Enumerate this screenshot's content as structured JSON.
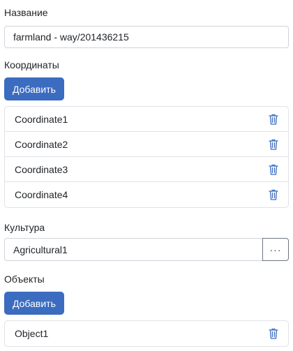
{
  "name": {
    "label": "Название",
    "value": "farmland - way/201436215"
  },
  "coordinates": {
    "label": "Координаты",
    "add_label": "Добавить",
    "items": [
      "Coordinate1",
      "Coordinate2",
      "Coordinate3",
      "Coordinate4"
    ]
  },
  "culture": {
    "label": "Культура",
    "value": "Agricultural1",
    "more_label": "···"
  },
  "objects": {
    "label": "Объекты",
    "add_label": "Добавить",
    "items": [
      "Object1"
    ]
  },
  "colors": {
    "primary": "#3b6cc0",
    "trash_icon": "#3b6cc0",
    "border": "#dfe2e6"
  },
  "icons": {
    "delete": "trash-icon",
    "more": "ellipsis-icon"
  }
}
